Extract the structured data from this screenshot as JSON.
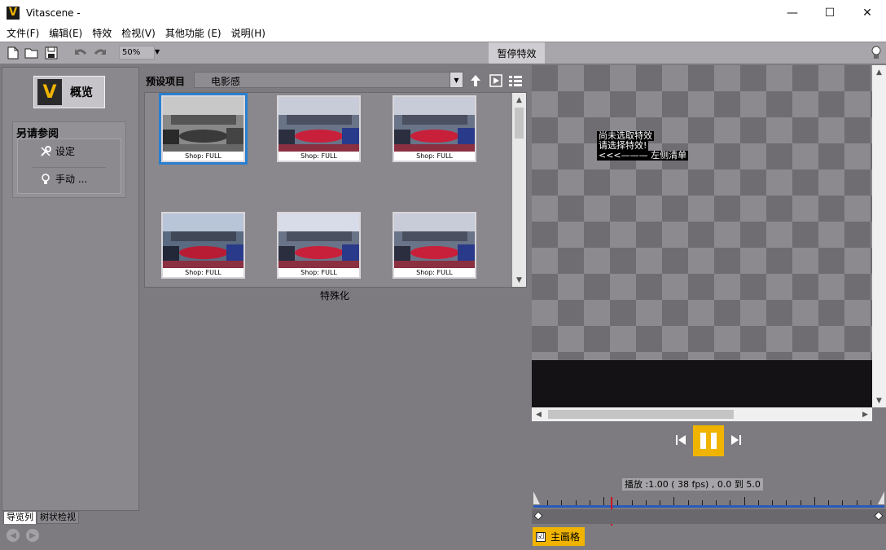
{
  "window": {
    "title": "Vitascene -",
    "logo_letter": "V",
    "controls": {
      "minimize": "—",
      "maximize": "☐",
      "close": "✕"
    }
  },
  "menu": [
    "文件(F)",
    "编辑(E)",
    "特效",
    "检视(V)",
    "其他功能 (E)",
    "说明(H)"
  ],
  "toolbar": {
    "zoom": "50%",
    "pause_effects": "暂停特效"
  },
  "left_panel": {
    "overview_label": "概览",
    "see_also_title": "另请参阅",
    "links": [
      {
        "label": "设定",
        "icon": "wrench-icon"
      },
      {
        "label": "手动 ...",
        "icon": "bulb-icon"
      }
    ],
    "tabs": [
      "导览列",
      "树状检视"
    ]
  },
  "presets": {
    "label": "预设项目",
    "selected": "电影感",
    "thumbnails": [
      {
        "label": "Shop: FULL",
        "selected": true,
        "tone": "bw"
      },
      {
        "label": "Shop: FULL",
        "selected": false,
        "tone": "color"
      },
      {
        "label": "Shop: FULL",
        "selected": false,
        "tone": "color"
      },
      {
        "label": "Shop: FULL",
        "selected": false,
        "tone": "color"
      },
      {
        "label": "Shop: FULL",
        "selected": false,
        "tone": "color"
      },
      {
        "label": "Shop: FULL",
        "selected": false,
        "tone": "color"
      }
    ],
    "category": "特殊化"
  },
  "preview": {
    "message": [
      "尚未选取特效",
      "请选择特效!",
      "<<<——— 左侧清单"
    ]
  },
  "playback": {
    "status": "播放 :1.00 ( 38 fps) , 0.0 到 5.0",
    "playhead": 0.22
  },
  "master_grid": {
    "label": "主画格",
    "checked": true,
    "check_mark": "☑"
  },
  "colors": {
    "accent": "#f0b400",
    "selection": "#2a7fd0",
    "timeline": "#2a5ab8",
    "playhead": "#d01020"
  }
}
